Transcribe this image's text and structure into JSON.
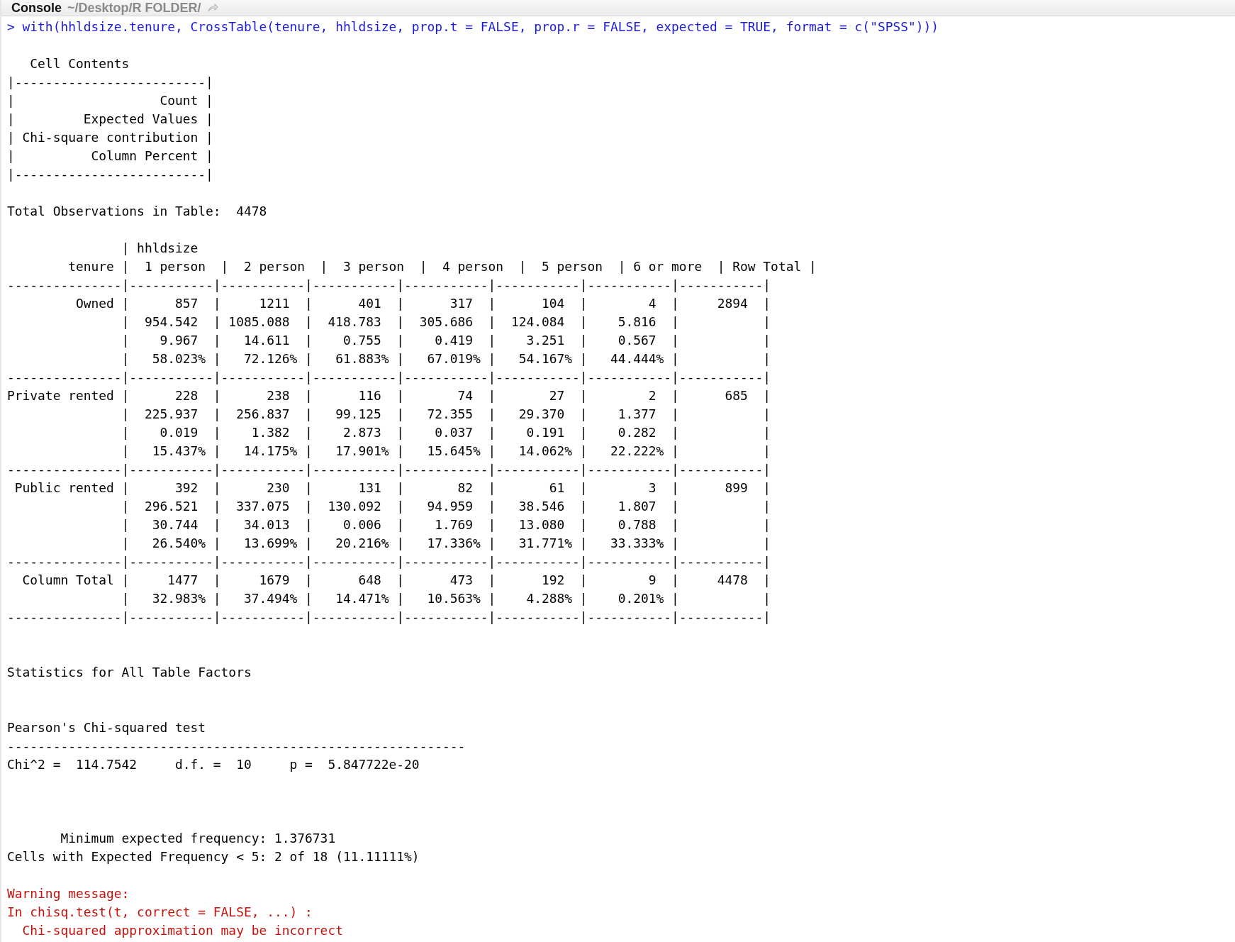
{
  "console": {
    "title": "Console",
    "path": "~/Desktop/R FOLDER/"
  },
  "lines": [
    {
      "kind": "command",
      "prompt": ">",
      "text": "with(hhldsize.tenure, CrossTable(tenure, hhldsize, prop.t = FALSE, prop.r = FALSE, expected = TRUE, format = c(\"SPSS\")))"
    },
    {
      "kind": "blank"
    },
    {
      "kind": "output",
      "text": "   Cell Contents"
    },
    {
      "kind": "output",
      "text": "|-------------------------|"
    },
    {
      "kind": "output",
      "text": "|                   Count |"
    },
    {
      "kind": "output",
      "text": "|         Expected Values |"
    },
    {
      "kind": "output",
      "text": "| Chi-square contribution |"
    },
    {
      "kind": "output",
      "text": "|          Column Percent |"
    },
    {
      "kind": "output",
      "text": "|-------------------------|"
    },
    {
      "kind": "blank"
    },
    {
      "kind": "output",
      "text": "Total Observations in Table:  4478"
    },
    {
      "kind": "blank"
    },
    {
      "kind": "output",
      "text": "               | hhldsize"
    },
    {
      "kind": "output",
      "text": "        tenure |  1 person  |  2 person  |  3 person  |  4 person  |  5 person  | 6 or more  | Row Total |"
    },
    {
      "kind": "output",
      "text": "---------------|-----------|-----------|-----------|-----------|-----------|-----------|-----------|"
    },
    {
      "kind": "output",
      "text": "         Owned |      857  |     1211  |      401  |      317  |      104  |        4  |     2894  |"
    },
    {
      "kind": "output",
      "text": "               |  954.542  | 1085.088  |  418.783  |  305.686  |  124.084  |    5.816  |           |"
    },
    {
      "kind": "output",
      "text": "               |    9.967  |   14.611  |    0.755  |    0.419  |    3.251  |    0.567  |           |"
    },
    {
      "kind": "output",
      "text": "               |   58.023% |   72.126% |   61.883% |   67.019% |   54.167% |   44.444% |           |"
    },
    {
      "kind": "output",
      "text": "---------------|-----------|-----------|-----------|-----------|-----------|-----------|-----------|"
    },
    {
      "kind": "output",
      "text": "Private rented |      228  |      238  |      116  |       74  |       27  |        2  |      685  |"
    },
    {
      "kind": "output",
      "text": "               |  225.937  |  256.837  |   99.125  |   72.355  |   29.370  |    1.377  |           |"
    },
    {
      "kind": "output",
      "text": "               |    0.019  |    1.382  |    2.873  |    0.037  |    0.191  |    0.282  |           |"
    },
    {
      "kind": "output",
      "text": "               |   15.437% |   14.175% |   17.901% |   15.645% |   14.062% |   22.222% |           |"
    },
    {
      "kind": "output",
      "text": "---------------|-----------|-----------|-----------|-----------|-----------|-----------|-----------|"
    },
    {
      "kind": "output",
      "text": " Public rented |      392  |      230  |      131  |       82  |       61  |        3  |      899  |"
    },
    {
      "kind": "output",
      "text": "               |  296.521  |  337.075  |  130.092  |   94.959  |   38.546  |    1.807  |           |"
    },
    {
      "kind": "output",
      "text": "               |   30.744  |   34.013  |    0.006  |    1.769  |   13.080  |    0.788  |           |"
    },
    {
      "kind": "output",
      "text": "               |   26.540% |   13.699% |   20.216% |   17.336% |   31.771% |   33.333% |           |"
    },
    {
      "kind": "output",
      "text": "---------------|-----------|-----------|-----------|-----------|-----------|-----------|-----------|"
    },
    {
      "kind": "output",
      "text": "  Column Total |     1477  |     1679  |      648  |      473  |      192  |        9  |     4478  |"
    },
    {
      "kind": "output",
      "text": "               |   32.983% |   37.494% |   14.471% |   10.563% |    4.288% |    0.201% |           |"
    },
    {
      "kind": "output",
      "text": "---------------|-----------|-----------|-----------|-----------|-----------|-----------|-----------|"
    },
    {
      "kind": "blank"
    },
    {
      "kind": "blank"
    },
    {
      "kind": "output",
      "text": "Statistics for All Table Factors"
    },
    {
      "kind": "blank"
    },
    {
      "kind": "blank"
    },
    {
      "kind": "output",
      "text": "Pearson's Chi-squared test"
    },
    {
      "kind": "output",
      "text": "------------------------------------------------------------"
    },
    {
      "kind": "output",
      "text": "Chi^2 =  114.7542     d.f. =  10     p =  5.847722e-20"
    },
    {
      "kind": "blank"
    },
    {
      "kind": "blank"
    },
    {
      "kind": "blank"
    },
    {
      "kind": "output",
      "text": "       Minimum expected frequency: 1.376731"
    },
    {
      "kind": "output",
      "text": "Cells with Expected Frequency < 5: 2 of 18 (11.11111%)"
    },
    {
      "kind": "blank"
    },
    {
      "kind": "warning",
      "text": "Warning message:"
    },
    {
      "kind": "warning",
      "text": "In chisq.test(t, correct = FALSE, ...) :"
    },
    {
      "kind": "warning",
      "text": "  Chi-squared approximation may be incorrect"
    }
  ]
}
